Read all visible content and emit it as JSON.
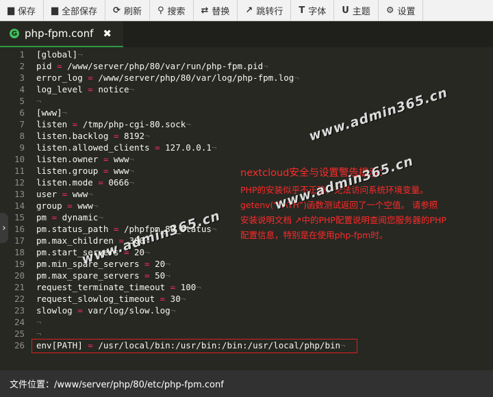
{
  "toolbar": {
    "items": [
      {
        "label": "保存",
        "icon": "save-icon"
      },
      {
        "label": "全部保存",
        "icon": "save-all-icon"
      },
      {
        "label": "刷新",
        "icon": "refresh-icon"
      },
      {
        "label": "搜索",
        "icon": "search-icon"
      },
      {
        "label": "替换",
        "icon": "replace-icon"
      },
      {
        "label": "跳转行",
        "icon": "jump-icon"
      },
      {
        "label": "字体",
        "icon": "font-icon"
      },
      {
        "label": "主题",
        "icon": "theme-icon"
      },
      {
        "label": "设置",
        "icon": "gear-icon"
      }
    ]
  },
  "tab": {
    "name": "php-fpm.conf",
    "close_glyph": "✖"
  },
  "code_lines": [
    {
      "n": "1",
      "key": "[global]",
      "val": ""
    },
    {
      "n": "2",
      "key": "pid",
      "val": "/www/server/php/80/var/run/php-fpm.pid"
    },
    {
      "n": "3",
      "key": "error_log",
      "val": "/www/server/php/80/var/log/php-fpm.log"
    },
    {
      "n": "4",
      "key": "log_level",
      "val": "notice"
    },
    {
      "n": "5",
      "key": "",
      "val": ""
    },
    {
      "n": "6",
      "key": "[www]",
      "val": ""
    },
    {
      "n": "7",
      "key": "listen",
      "val": "/tmp/php-cgi-80.sock"
    },
    {
      "n": "8",
      "key": "listen.backlog",
      "val": "8192"
    },
    {
      "n": "9",
      "key": "listen.allowed_clients",
      "val": "127.0.0.1"
    },
    {
      "n": "10",
      "key": "listen.owner",
      "val": "www"
    },
    {
      "n": "11",
      "key": "listen.group",
      "val": "www"
    },
    {
      "n": "12",
      "key": "listen.mode",
      "val": "0666"
    },
    {
      "n": "13",
      "key": "user",
      "val": "www"
    },
    {
      "n": "14",
      "key": "group",
      "val": "www"
    },
    {
      "n": "15",
      "key": "pm",
      "val": "dynamic"
    },
    {
      "n": "16",
      "key": "pm.status_path",
      "val": "/phpfpm_80_status"
    },
    {
      "n": "17",
      "key": "pm.max_children",
      "val": "300"
    },
    {
      "n": "18",
      "key": "pm.start_servers",
      "val": "20"
    },
    {
      "n": "19",
      "key": "pm.min_spare_servers",
      "val": "20"
    },
    {
      "n": "20",
      "key": "pm.max_spare_servers",
      "val": "50"
    },
    {
      "n": "21",
      "key": "request_terminate_timeout",
      "val": "100"
    },
    {
      "n": "22",
      "key": "request_slowlog_timeout",
      "val": "30"
    },
    {
      "n": "23",
      "key": "slowlog",
      "val": "var/log/slow.log"
    },
    {
      "n": "24",
      "key": "",
      "val": ""
    },
    {
      "n": "25",
      "key": "",
      "val": ""
    },
    {
      "n": "26",
      "key": "env[PATH]",
      "val": "/usr/local/bin:/usr/bin:/bin:/usr/local/php/bin"
    }
  ],
  "note": {
    "title": "nextcloud安全与设置警告提示：",
    "lines": [
      "PHP的安装似乎不正确，无法访问系统环境变量。",
      "getenv(“PATH”)函数测试返回了一个空值。 请参照",
      "安装说明文档 ↗中的PHP配置说明查阅您服务器的PHP",
      "配置信息，特别是在使用php-fpm时。"
    ]
  },
  "watermarks": [
    "www.admin365.cn",
    "www.admin365.cn",
    "www.admin365.cn"
  ],
  "status": {
    "path": "文件位置：/www/server/php/80/etc/php-fpm.conf"
  },
  "colors": {
    "key_eq": "#f92672",
    "highlight": "#e02020",
    "note": "#ff2a2a",
    "tab_accent": "#2e9a44"
  }
}
